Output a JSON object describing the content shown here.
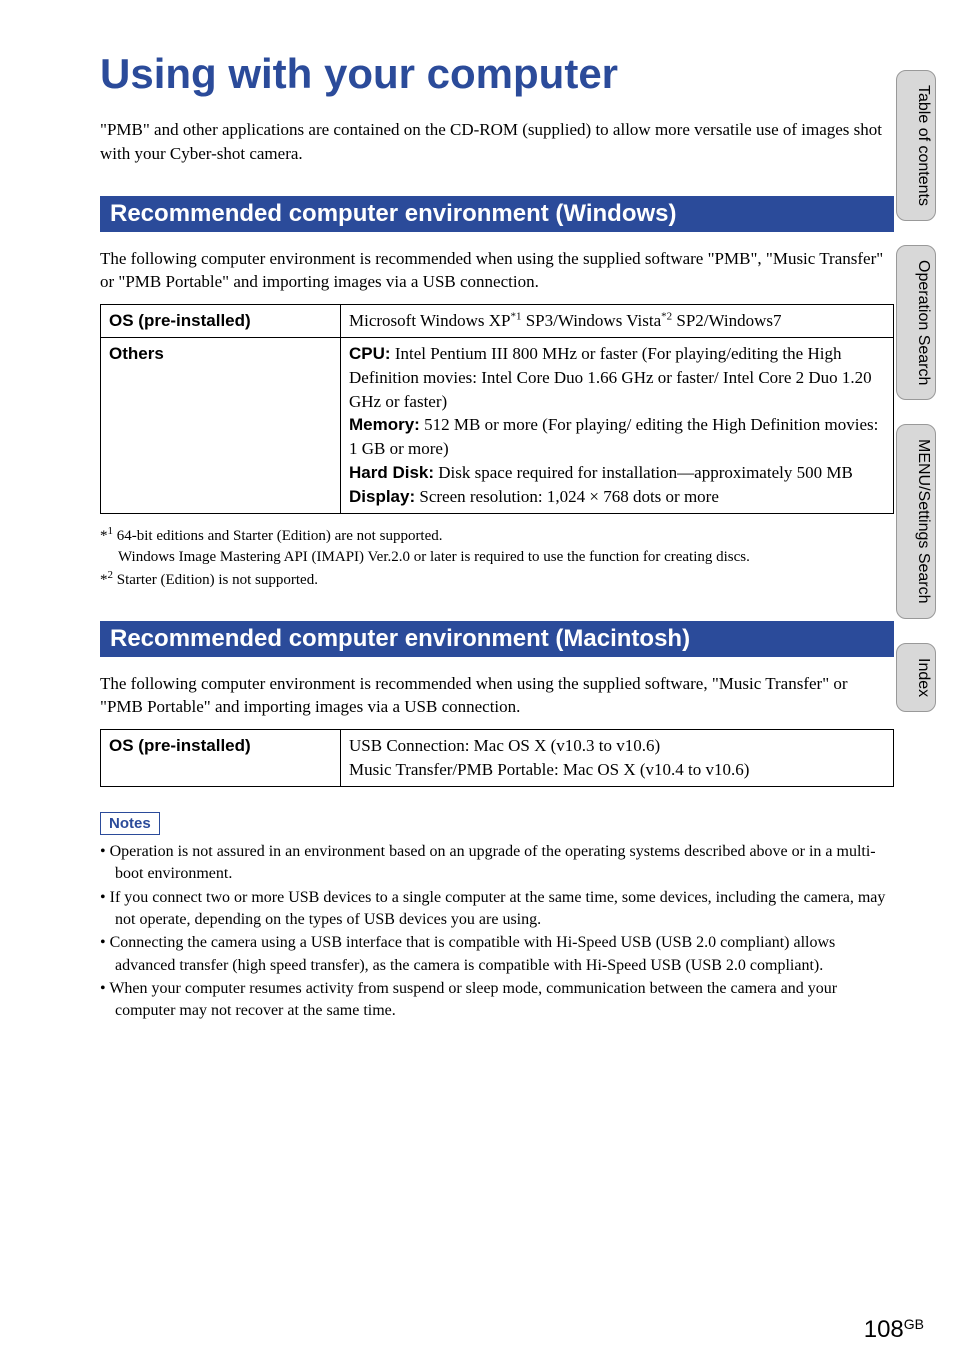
{
  "page": {
    "title": "Using with your computer",
    "intro": "\"PMB\" and other applications are contained on the CD-ROM (supplied) to allow more versatile use of images shot with your Cyber-shot camera.",
    "page_num": "108",
    "page_lang": "GB"
  },
  "side_tabs": {
    "toc": "Table of contents",
    "operation": "Operation Search",
    "menu": "MENU/Settings Search",
    "index": "Index"
  },
  "section_win": {
    "heading": "Recommended computer environment (Windows)",
    "intro": "The following computer environment is recommended when using the supplied software \"PMB\", \"Music Transfer\" or \"PMB Portable\" and importing images via a USB connection.",
    "row1_label": "OS (pre-installed)",
    "row1_value_pre": "Microsoft Windows XP",
    "row1_value_mid": " SP3/Windows Vista",
    "row1_value_post": " SP2/Windows7",
    "row2_label": "Others",
    "cpu_label": "CPU:",
    "cpu_text": " Intel Pentium III 800 MHz or faster (For playing/editing the High Definition movies: Intel Core Duo 1.66 GHz or faster/ Intel Core 2 Duo 1.20 GHz or faster)",
    "mem_label": "Memory:",
    "mem_text": " 512 MB or more (For playing/ editing the High Definition movies: 1 GB or more)",
    "hd_label": "Hard Disk:",
    "hd_text": " Disk space required for installation—approximately 500 MB",
    "disp_label": "Display:",
    "disp_text": " Screen resolution: 1,024 × 768 dots or more",
    "foot1_pre": "*",
    "foot1_text": " 64-bit editions and Starter (Edition) are not supported.",
    "foot1_line2": "Windows Image Mastering API (IMAPI) Ver.2.0 or later is required to use the function for creating discs.",
    "foot2_pre": "*",
    "foot2_text": " Starter (Edition) is not supported."
  },
  "section_mac": {
    "heading": "Recommended computer environment (Macintosh)",
    "intro": "The following computer environment is recommended when using the supplied software, \"Music Transfer\" or \"PMB Portable\" and importing images via a USB connection.",
    "row1_label": "OS (pre-installed)",
    "row1_line1": "USB Connection: Mac OS X (v10.3 to v10.6)",
    "row1_line2": "Music Transfer/PMB Portable: Mac OS X (v10.4 to v10.6)"
  },
  "notes": {
    "label": "Notes",
    "items": [
      "Operation is not assured in an environment based on an upgrade of the operating systems described above or in a multi-boot environment.",
      "If you connect two or more USB devices to a single computer at the same time, some devices, including the camera, may not operate, depending on the types of USB devices you are using.",
      "Connecting the camera using a USB interface that is compatible with Hi-Speed USB (USB 2.0 compliant) allows advanced transfer (high speed transfer), as the camera is compatible with Hi-Speed USB (USB 2.0 compliant).",
      "When your computer resumes activity from suspend or sleep mode, communication between the camera and your computer may not recover at the same time."
    ]
  }
}
